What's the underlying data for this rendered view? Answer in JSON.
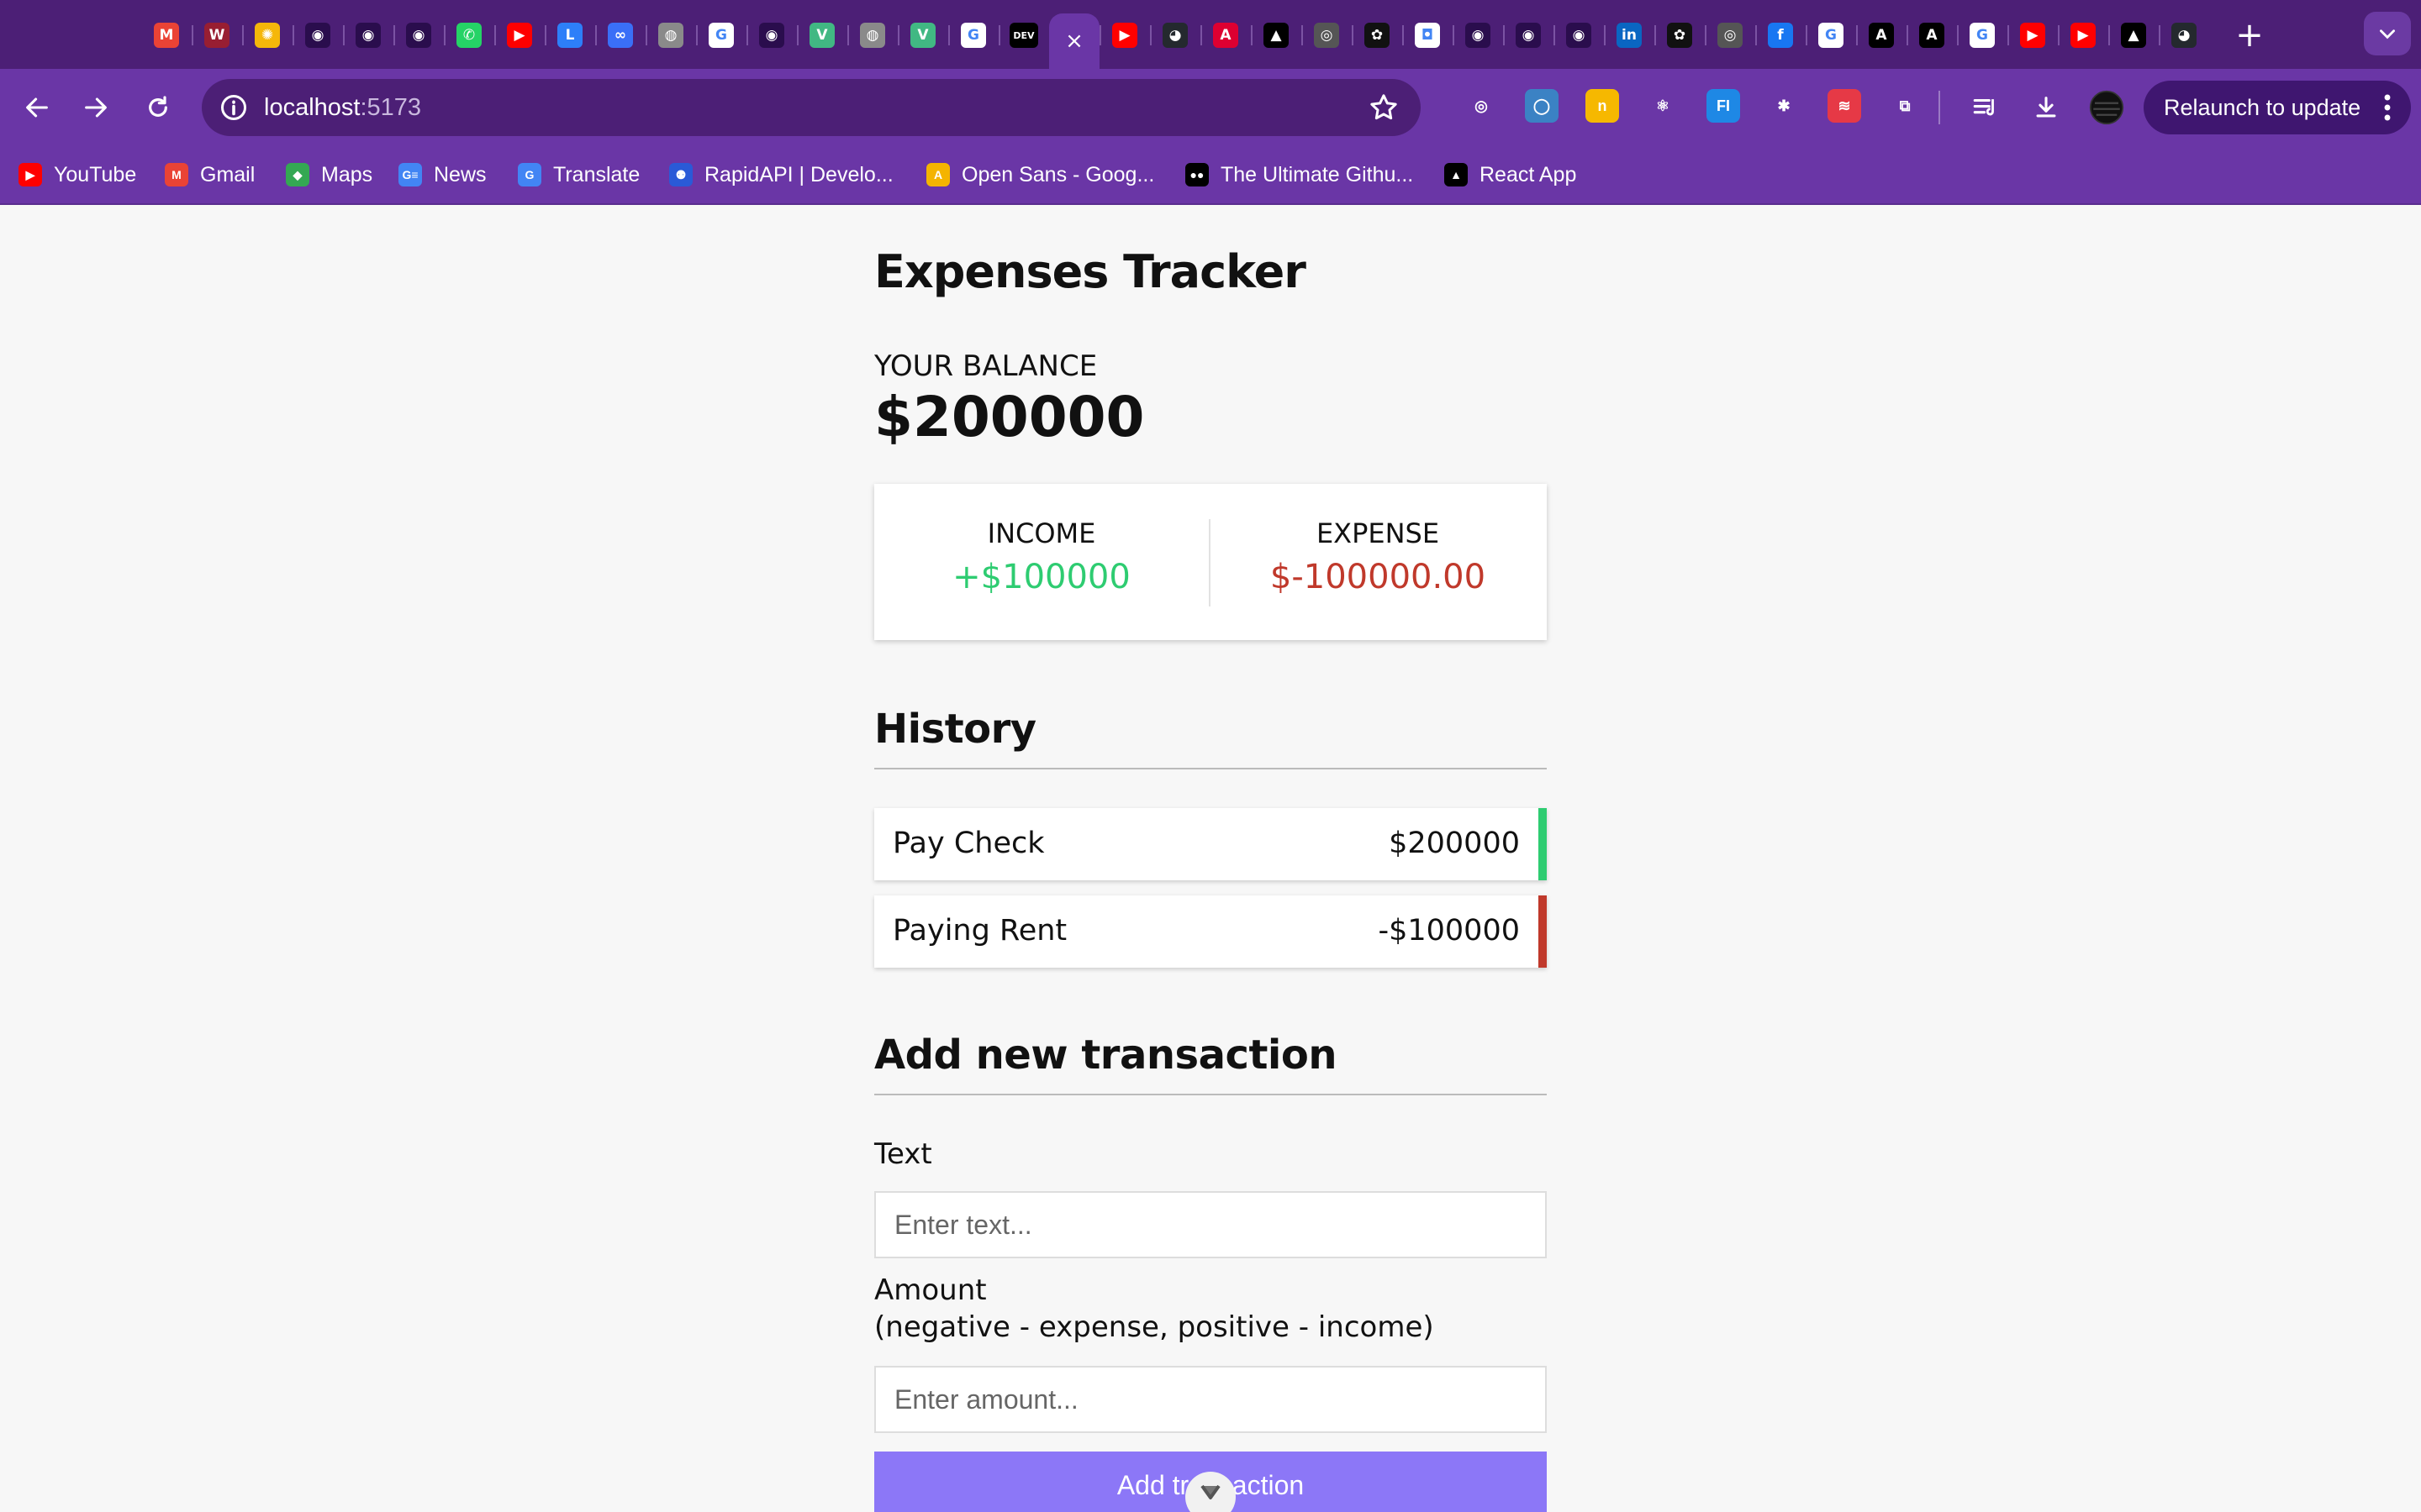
{
  "browser": {
    "tabs": [
      {
        "icon": "gmail-icon",
        "glyph": "M",
        "color": "#ea4335"
      },
      {
        "icon": "wsu-icon",
        "glyph": "W",
        "color": "#981e32"
      },
      {
        "icon": "sun-icon",
        "glyph": "✺",
        "color": "#f5b70a"
      },
      {
        "icon": "openai-icon",
        "glyph": "◉",
        "color": "#2a0d4d"
      },
      {
        "icon": "openai-icon",
        "glyph": "◉",
        "color": "#2a0d4d"
      },
      {
        "icon": "openai-icon",
        "glyph": "◉",
        "color": "#2a0d4d"
      },
      {
        "icon": "whatsapp-icon",
        "glyph": "✆",
        "color": "#25d366"
      },
      {
        "icon": "youtube-icon",
        "glyph": "▶",
        "color": "#ff0000"
      },
      {
        "icon": "linkedin-learning-icon",
        "glyph": "L",
        "color": "#2d7ff9"
      },
      {
        "icon": "meta-icon",
        "glyph": "∞",
        "color": "#3a6ff7"
      },
      {
        "icon": "globe-icon",
        "glyph": "◍",
        "color": "#8a8a8a"
      },
      {
        "icon": "google-icon",
        "glyph": "G",
        "color": "#ffffff"
      },
      {
        "icon": "openai-icon",
        "glyph": "◉",
        "color": "#2a0d4d"
      },
      {
        "icon": "vuejs-icon",
        "glyph": "V",
        "color": "#41b883"
      },
      {
        "icon": "globe-icon",
        "glyph": "◍",
        "color": "#8a8a8a"
      },
      {
        "icon": "vuejs-icon",
        "glyph": "V",
        "color": "#41b883"
      },
      {
        "icon": "google-icon",
        "glyph": "G",
        "color": "#ffffff"
      },
      {
        "icon": "dev-icon",
        "glyph": "DEV",
        "color": "#000000"
      },
      {
        "icon": "close-icon",
        "glyph": "×",
        "color": "#6a36a6",
        "active": true
      },
      {
        "icon": "youtube-icon",
        "glyph": "▶",
        "color": "#ff0000"
      },
      {
        "icon": "github-icon",
        "glyph": "◕",
        "color": "#24292e"
      },
      {
        "icon": "angular-icon",
        "glyph": "A",
        "color": "#dd0031"
      },
      {
        "icon": "triangle-icon",
        "glyph": "▲",
        "color": "#000000"
      },
      {
        "icon": "chrome-icon",
        "glyph": "◎",
        "color": "#555555"
      },
      {
        "icon": "openai-icon",
        "glyph": "✿",
        "color": "#111111"
      },
      {
        "icon": "tool-icon",
        "glyph": "◘",
        "color": "#ffffff"
      },
      {
        "icon": "openai-icon",
        "glyph": "◉",
        "color": "#2a0d4d"
      },
      {
        "icon": "openai-icon",
        "glyph": "◉",
        "color": "#2a0d4d"
      },
      {
        "icon": "openai-icon",
        "glyph": "◉",
        "color": "#2a0d4d"
      },
      {
        "icon": "linkedin-icon",
        "glyph": "in",
        "color": "#0a66c2"
      },
      {
        "icon": "openai-icon",
        "glyph": "✿",
        "color": "#111111"
      },
      {
        "icon": "chrome-icon",
        "glyph": "◎",
        "color": "#555555"
      },
      {
        "icon": "facebook-icon",
        "glyph": "f",
        "color": "#1877f2"
      },
      {
        "icon": "google-icon",
        "glyph": "G",
        "color": "#ffffff"
      },
      {
        "icon": "arc-icon",
        "glyph": "A",
        "color": "#000000"
      },
      {
        "icon": "arc-icon",
        "glyph": "A",
        "color": "#000000"
      },
      {
        "icon": "google-icon",
        "glyph": "G",
        "color": "#ffffff"
      },
      {
        "icon": "youtube-icon",
        "glyph": "▶",
        "color": "#ff0000"
      },
      {
        "icon": "youtube-icon",
        "glyph": "▶",
        "color": "#ff0000"
      },
      {
        "icon": "triangle-icon",
        "glyph": "▲",
        "color": "#000000"
      },
      {
        "icon": "github-icon",
        "glyph": "◕",
        "color": "#24292e"
      }
    ],
    "new_tab_glyph": "+",
    "url_host": "localhost",
    "url_port": ":5173",
    "relaunch_label": "Relaunch to update",
    "extensions": [
      {
        "icon": "target-icon",
        "glyph": "◎",
        "color": "#6a36a6"
      },
      {
        "icon": "circle-icon",
        "glyph": "◯",
        "color": "#3b82c4"
      },
      {
        "icon": "rn-icon",
        "glyph": "n",
        "color": "#f6b800"
      },
      {
        "icon": "react-icon",
        "glyph": "⚛",
        "color": "#6a36a6"
      },
      {
        "icon": "fi-icon",
        "glyph": "FI",
        "color": "#1e88e5"
      },
      {
        "icon": "asterisk-icon",
        "glyph": "✱",
        "color": "#6a36a6"
      },
      {
        "icon": "red-badge-icon",
        "glyph": "≋",
        "color": "#e63946"
      },
      {
        "icon": "puzzle-icon",
        "glyph": "⧉",
        "color": "#6a36a6"
      }
    ],
    "bookmarks": [
      {
        "label": "YouTube",
        "icon": "youtube-icon",
        "glyph": "▶",
        "color": "#ff0000"
      },
      {
        "label": "Gmail",
        "icon": "gmail-icon",
        "glyph": "M",
        "color": "#ea4335"
      },
      {
        "label": "Maps",
        "icon": "maps-icon",
        "glyph": "◆",
        "color": "#34a853"
      },
      {
        "label": "News",
        "icon": "news-icon",
        "glyph": "G≡",
        "color": "#4285f4"
      },
      {
        "label": "Translate",
        "icon": "translate-icon",
        "glyph": "G",
        "color": "#4285f4"
      },
      {
        "label": "RapidAPI | Develo...",
        "icon": "rapidapi-icon",
        "glyph": "⚉",
        "color": "#2a5ad7"
      },
      {
        "label": "Open Sans - Goog...",
        "icon": "google-fonts-icon",
        "glyph": "A",
        "color": "#f4b400"
      },
      {
        "label": "The Ultimate Githu...",
        "icon": "medium-icon",
        "glyph": "●●",
        "color": "#000000"
      },
      {
        "label": "React App",
        "icon": "react-app-icon",
        "glyph": "▲",
        "color": "#000000"
      }
    ]
  },
  "app": {
    "title": "Expenses Tracker",
    "balance_label": "YOUR BALANCE",
    "balance_value": "$200000",
    "income_label": "INCOME",
    "income_value": "+$100000",
    "expense_label": "EXPENSE",
    "expense_value": "$-100000.00",
    "history_title": "History",
    "history": [
      {
        "text": "Pay Check",
        "amount": "$200000",
        "type": "plus",
        "color": "#2ecc71"
      },
      {
        "text": "Paying Rent",
        "amount": "-$100000",
        "type": "minus",
        "color": "#c0392b"
      }
    ],
    "add_title": "Add new transaction",
    "text_label": "Text",
    "text_placeholder": "Enter text...",
    "amount_label": "Amount",
    "amount_hint": "(negative - expense, positive - income)",
    "amount_placeholder": "Enter amount...",
    "submit_label": "Add transaction",
    "accent": "#8c77f7"
  }
}
